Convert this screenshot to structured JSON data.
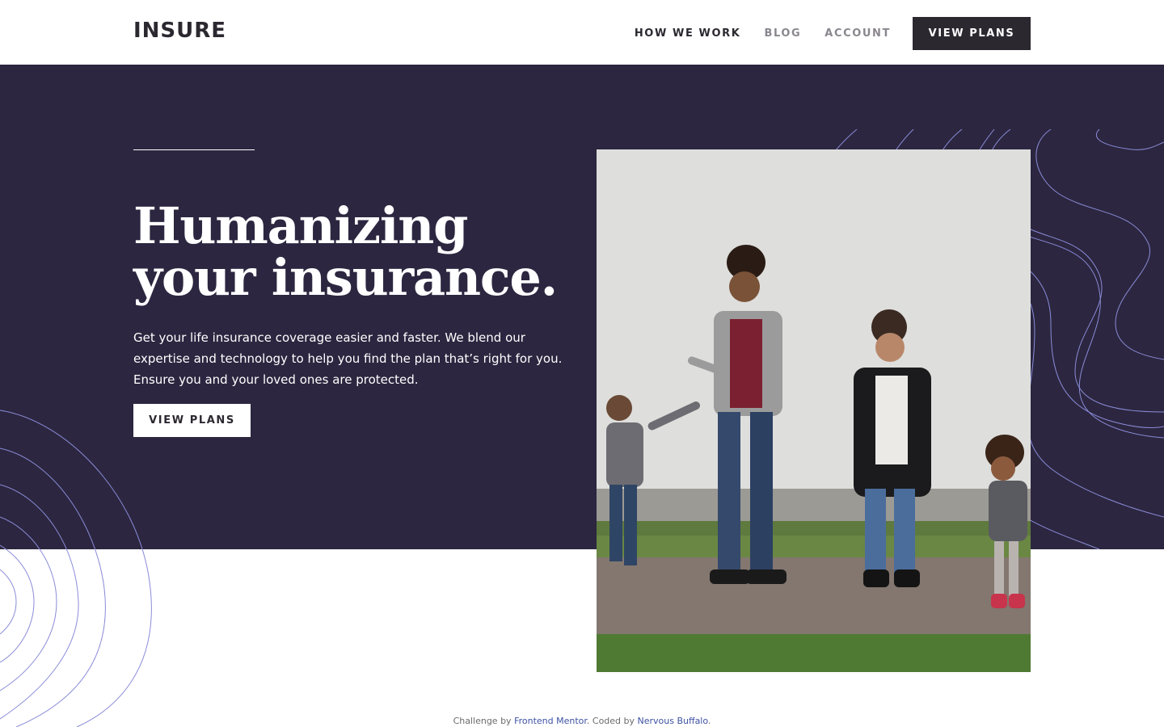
{
  "brand": {
    "name": "INSURE",
    "colors": {
      "dark": "#2c2830",
      "hero_bg": "#2c2640",
      "line_accent": "#8a8cd8",
      "link": "#3e52a3",
      "muted_nav": "#8a868e"
    }
  },
  "nav": {
    "items": [
      {
        "label": "HOW WE WORK"
      },
      {
        "label": "BLOG"
      },
      {
        "label": "ACCOUNT"
      }
    ],
    "cta_label": "VIEW PLANS"
  },
  "hero": {
    "title": "Humanizing your insurance.",
    "description": "Get your life insurance coverage easier and faster. We blend our expertise and technology to help you find the plan that’s right for you. Ensure you and your loved ones are protected.",
    "cta_label": "VIEW PLANS",
    "image": {
      "icon": "family-photo"
    }
  },
  "footer": {
    "prefix": "Challenge by",
    "challenge_link": "Frontend Mentor",
    "middle": ". Coded by",
    "author_link": "Nervous Buffalo",
    "suffix": "."
  }
}
